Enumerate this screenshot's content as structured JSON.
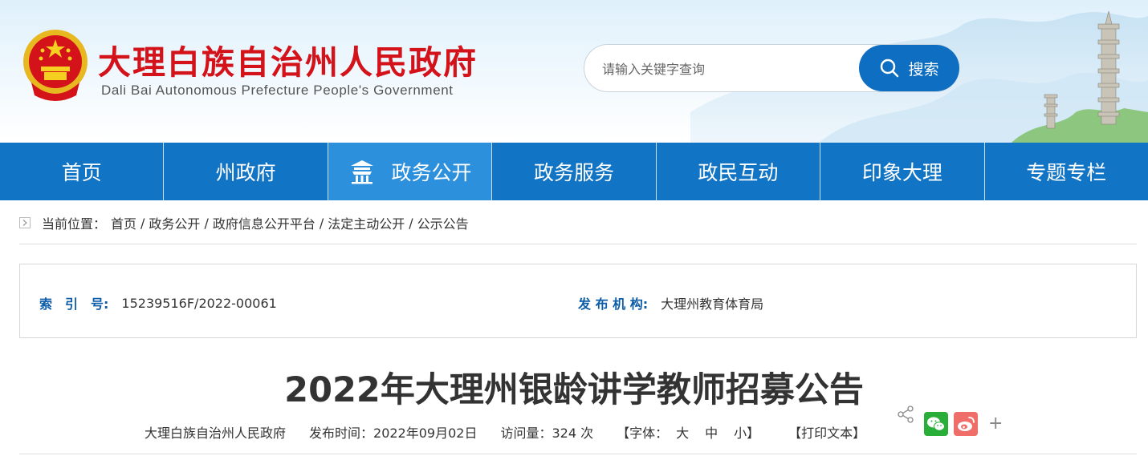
{
  "header": {
    "title": "大理白族自治州人民政府",
    "subtitle": "Dali Bai Autonomous Prefecture People's Government",
    "emblem_icon": "national-emblem-icon",
    "brand_color": "#d3121a"
  },
  "search": {
    "placeholder": "请输入关键字查询",
    "button_label": "搜索",
    "icon": "search-icon"
  },
  "nav": {
    "background": "#1274c5",
    "active_background": "#2d90dc",
    "items": [
      {
        "label": "首页"
      },
      {
        "label": "州政府"
      },
      {
        "label": "政务公开",
        "active": true,
        "icon": "pavilion-icon"
      },
      {
        "label": "政务服务"
      },
      {
        "label": "政民互动"
      },
      {
        "label": "印象大理"
      },
      {
        "label": "专题专栏"
      }
    ]
  },
  "breadcrumb": {
    "prefix": "当前位置：",
    "items": [
      "首页",
      "政务公开",
      "政府信息公开平台",
      "法定主动公开",
      "公示公告"
    ],
    "separator": "/"
  },
  "meta": {
    "index_label": "索　引　号:",
    "index_value": "15239516F/2022-00061",
    "org_label": "发 布 机 构:",
    "org_value": "大理州教育体育局",
    "label_color": "#0e5da8"
  },
  "article": {
    "title": "2022年大理州银龄讲学教师招募公告",
    "source": "大理白族自治州人民政府",
    "publish_time": "发布时间：2022年09月02日",
    "visits": "访问量：324 次",
    "font_prefix": "【字体：",
    "font_large": "大",
    "font_medium": "中",
    "font_small": "小】",
    "print_label": "【打印文本】"
  },
  "share": {
    "icons": [
      "share-icon",
      "wechat-icon",
      "weibo-icon",
      "plus-icon"
    ],
    "plus_label": "+",
    "wechat_color": "#2aae3a",
    "weibo_color": "#f06e6a"
  }
}
